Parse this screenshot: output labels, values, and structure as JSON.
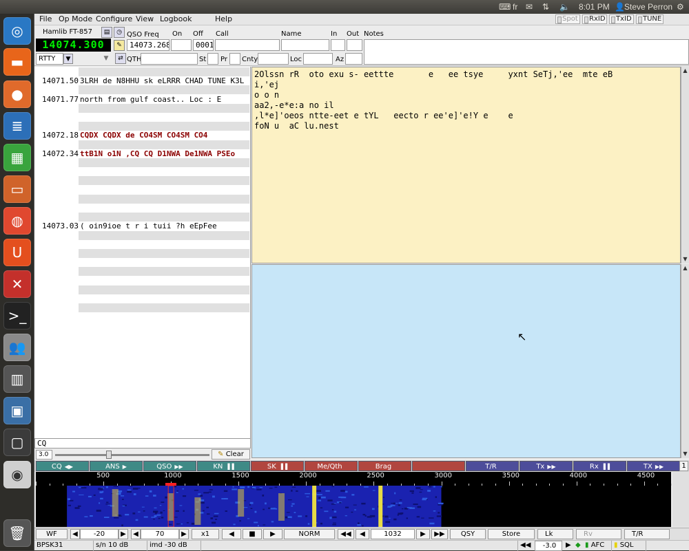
{
  "system": {
    "keyboard": "fr",
    "time": "8:01 PM",
    "user": "Steve Perron"
  },
  "menu": {
    "items": [
      "File",
      "Op Mode",
      "Configure",
      "View",
      "Logbook",
      "Help"
    ],
    "toggles": [
      "Spot",
      "RxID",
      "TxID",
      "TUNE"
    ]
  },
  "header": {
    "rig": "Hamlib FT-857",
    "frequency_display": "14074.300",
    "mode": "RTTY",
    "qso_freq_label": "QSO Freq",
    "qso_freq": "14073.268",
    "on_label": "On",
    "off_label": "Off",
    "off_value": "0001",
    "call_label": "Call",
    "name_label": "Name",
    "in_label": "In",
    "out_label": "Out",
    "notes_label": "Notes",
    "qth_label": "QTH",
    "st_label": "St",
    "pr_label": "Pr",
    "cnty_label": "Cnty",
    "loc_label": "Loc",
    "az_label": "Az"
  },
  "signal_browser": {
    "rows": [
      {
        "freq": "",
        "text": ""
      },
      {
        "freq": "14071.50",
        "text": "3LRH de N8HHU sk  eLRRR CHAD TUNE K3L"
      },
      {
        "freq": "",
        "text": ""
      },
      {
        "freq": "14071.77",
        "text": "north from gulf coast..    Loc    : E"
      },
      {
        "freq": "",
        "text": ""
      },
      {
        "freq": "",
        "text": ""
      },
      {
        "freq": "",
        "text": ""
      },
      {
        "freq": "14072.18",
        "text": "CQDX CQDX de CO4SM CO4SM CO4",
        "highlight": true
      },
      {
        "freq": "",
        "text": ""
      },
      {
        "freq": "14072.34",
        "text": "ttB1N o1N   ,CQ CQ D1NWA De1NWA  PSEo",
        "highlight": true
      },
      {
        "freq": "",
        "text": ""
      },
      {
        "freq": "",
        "text": ""
      },
      {
        "freq": "",
        "text": ""
      },
      {
        "freq": "",
        "text": ""
      },
      {
        "freq": "",
        "text": ""
      },
      {
        "freq": "",
        "text": ""
      },
      {
        "freq": "",
        "text": ""
      },
      {
        "freq": "14073.03",
        "text": "( oin9ioe  t  r i    tuii ?h   eEpFee"
      },
      {
        "freq": "",
        "text": ""
      },
      {
        "freq": "",
        "text": ""
      },
      {
        "freq": "",
        "text": ""
      },
      {
        "freq": "",
        "text": ""
      },
      {
        "freq": "",
        "text": ""
      },
      {
        "freq": "",
        "text": ""
      },
      {
        "freq": "",
        "text": ""
      },
      {
        "freq": "",
        "text": ""
      },
      {
        "freq": "",
        "text": ""
      },
      {
        "freq": "",
        "text": ""
      }
    ],
    "search_value": "CQ",
    "squelch_value": "3.0",
    "clear_label": "Clear"
  },
  "rx_text": "2Olssn rR  oto exu s- eettte       e   ee tsye     yxnt SeTj,'ee  mte eB\ni,'ej\no o n\naa2,-e*e:a no il\n,l*e]'oeos ntte-eet e tYL   eecto r ee'e]'e!Y e    e\nfoN u  aC lu.nest",
  "macros": [
    {
      "label": "CQ",
      "glyph": "◀▶",
      "color": "teal"
    },
    {
      "label": "ANS",
      "glyph": "▶",
      "color": "teal"
    },
    {
      "label": "QSO",
      "glyph": "▶▶",
      "color": "teal"
    },
    {
      "label": "KN",
      "glyph": "▐▐",
      "color": "teal"
    },
    {
      "label": "SK",
      "glyph": "▐▐",
      "color": "red"
    },
    {
      "label": "Me/Qth",
      "glyph": "",
      "color": "red"
    },
    {
      "label": "Brag",
      "glyph": "",
      "color": "red"
    },
    {
      "label": "",
      "glyph": "",
      "color": "red"
    },
    {
      "label": "T/R",
      "glyph": "",
      "color": "blue"
    },
    {
      "label": "Tx",
      "glyph": "▶▶",
      "color": "blue"
    },
    {
      "label": "Rx",
      "glyph": "▐▐",
      "color": "blue"
    },
    {
      "label": "TX",
      "glyph": "▶▶",
      "color": "blue"
    }
  ],
  "macro_set": "1",
  "waterfall": {
    "scale_labels": [
      "500",
      "1000",
      "1500",
      "2000",
      "2500",
      "3000",
      "3500",
      "4000",
      "4500"
    ],
    "scale_max_hz": 4700,
    "cursor_hz": 1000,
    "signal_hz": [
      590,
      1000,
      1200,
      1520,
      1820,
      2060,
      2550
    ]
  },
  "controls": {
    "wf_label": "WF",
    "ref_level": "-20",
    "range": "70",
    "zoom": "x1",
    "norm_label": "NORM",
    "audio_freq": "1032",
    "qsy_label": "QSY",
    "store_label": "Store",
    "lk_label": "Lk",
    "rv_label": "Rv",
    "tr_label": "T/R"
  },
  "status": {
    "mode": "BPSK31",
    "snr": "s/n 10 dB",
    "imd": "imd -30 dB",
    "offset": "-3.0",
    "afc_label": "AFC",
    "sql_label": "SQL"
  }
}
